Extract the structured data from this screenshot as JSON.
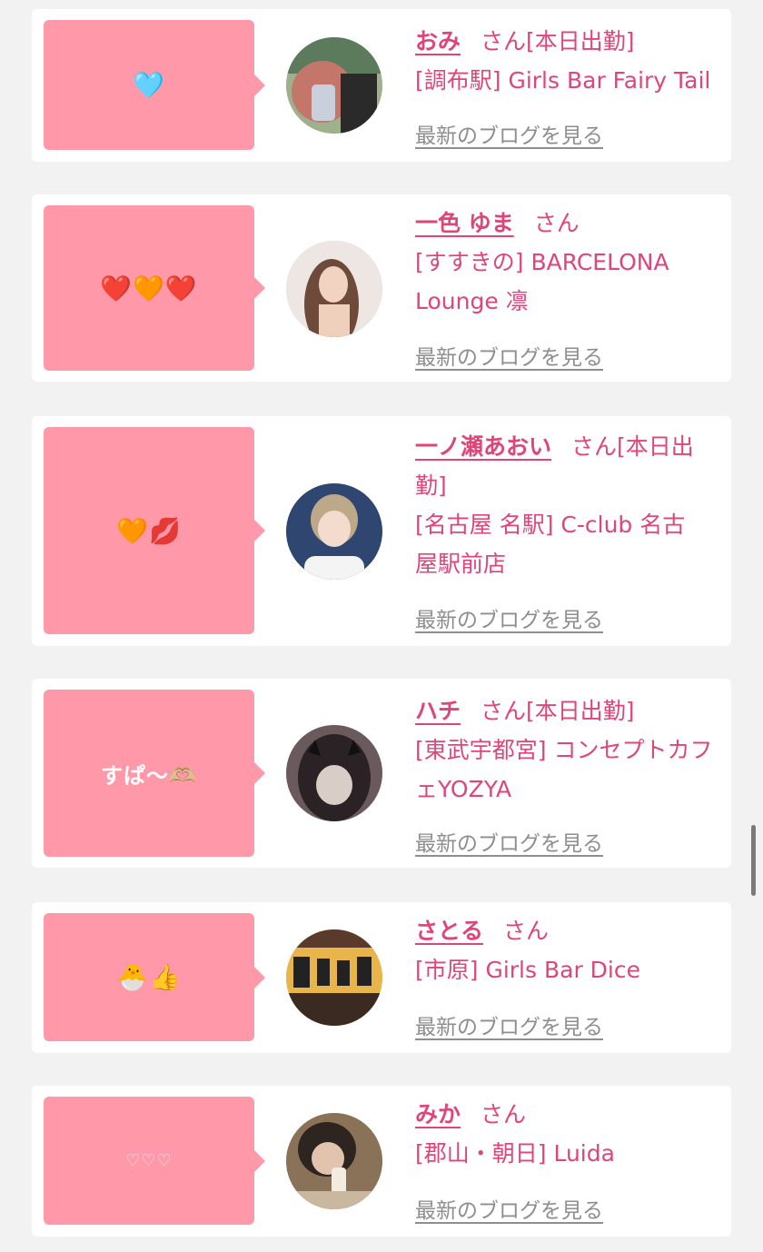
{
  "scrollbar": "scrollbar",
  "entries": [
    {
      "message": "🩵",
      "name": "おみ",
      "honorific": "さん",
      "status": "[本日出勤]",
      "shop": "[調布駅] Girls Bar Fairy Tail",
      "blog_link": "最新のブログを見る",
      "avatar_color": "#b8c4a8"
    },
    {
      "message": "❤️🧡❤️",
      "name": "一色 ゆま",
      "honorific": "さん",
      "status": "",
      "shop": "[すすきの] BARCELONA Lounge 凛",
      "blog_link": "最新のブログを見る",
      "avatar_color": "#e9dcd6"
    },
    {
      "message": "🧡💋",
      "name": "一ノ瀬あおい",
      "honorific": "さん",
      "status": "[本日出勤]",
      "shop": "[名古屋 名駅] C-club 名古屋駅前店",
      "blog_link": "最新のブログを見る",
      "avatar_color": "#3c4f78"
    },
    {
      "message": "すぱ〜🫶🏼",
      "name": "ハチ",
      "honorific": "さん",
      "status": "[本日出勤]",
      "shop": "[東武宇都宮] コンセプトカフェYOZYA",
      "blog_link": "最新のブログを見る",
      "avatar_color": "#3a2e30"
    },
    {
      "message": "🐣👍",
      "name": "さとる",
      "honorific": "さん",
      "status": "",
      "shop": "[市原] Girls Bar Dice",
      "blog_link": "最新のブログを見る",
      "avatar_color": "#e2a63a"
    },
    {
      "message": "♡♡♡",
      "name": "みか",
      "honorific": "さん",
      "status": "",
      "shop": "[郡山・朝日] Luida",
      "blog_link": "最新のブログを見る",
      "avatar_color": "#a88e70"
    }
  ]
}
